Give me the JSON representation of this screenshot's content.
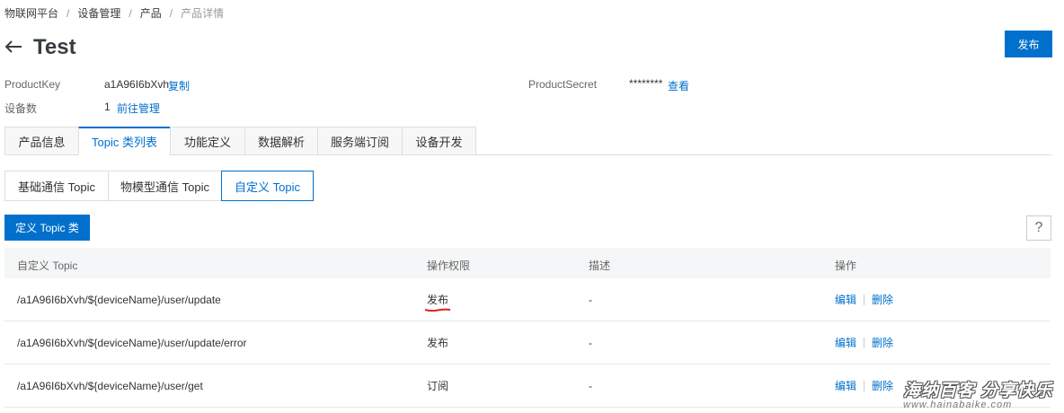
{
  "breadcrumb": {
    "items": [
      "物联网平台",
      "设备管理",
      "产品",
      "产品详情"
    ],
    "separator": "/"
  },
  "header": {
    "back_icon": "arrow-left-icon",
    "title": "Test",
    "publish_label": "发布"
  },
  "info": {
    "product_key_label": "ProductKey",
    "product_key_value": "a1A96I6bXvh",
    "copy_label": "复制",
    "product_secret_label": "ProductSecret",
    "product_secret_value": "********",
    "view_label": "查看",
    "device_count_label": "设备数",
    "device_count_value": "1",
    "manage_label": "前往管理"
  },
  "tabs": [
    {
      "label": "产品信息"
    },
    {
      "label": "Topic 类列表"
    },
    {
      "label": "功能定义"
    },
    {
      "label": "数据解析"
    },
    {
      "label": "服务端订阅"
    },
    {
      "label": "设备开发"
    }
  ],
  "active_tab": "Topic 类列表",
  "subtabs": [
    {
      "label": "基础通信 Topic"
    },
    {
      "label": "物模型通信 Topic"
    },
    {
      "label": "自定义 Topic"
    }
  ],
  "active_subtab": "自定义 Topic",
  "toolbar": {
    "define_label": "定义 Topic 类",
    "help_label": "?"
  },
  "table": {
    "columns": [
      "自定义 Topic",
      "操作权限",
      "描述",
      "操作"
    ],
    "rows": [
      {
        "topic": "/a1A96I6bXvh/${deviceName}/user/update",
        "permission": "发布",
        "desc": "-",
        "edit": "编辑",
        "delete": "删除"
      },
      {
        "topic": "/a1A96I6bXvh/${deviceName}/user/update/error",
        "permission": "发布",
        "desc": "-",
        "edit": "编辑",
        "delete": "删除"
      },
      {
        "topic": "/a1A96I6bXvh/${deviceName}/user/get",
        "permission": "订阅",
        "desc": "-",
        "edit": "编辑",
        "delete": "删除"
      }
    ]
  },
  "watermark": {
    "main": "海纳百客 分享快乐",
    "url": "www.hainabaike.com"
  },
  "colors": {
    "accent": "#0070cc",
    "annotation": "#e02020"
  }
}
